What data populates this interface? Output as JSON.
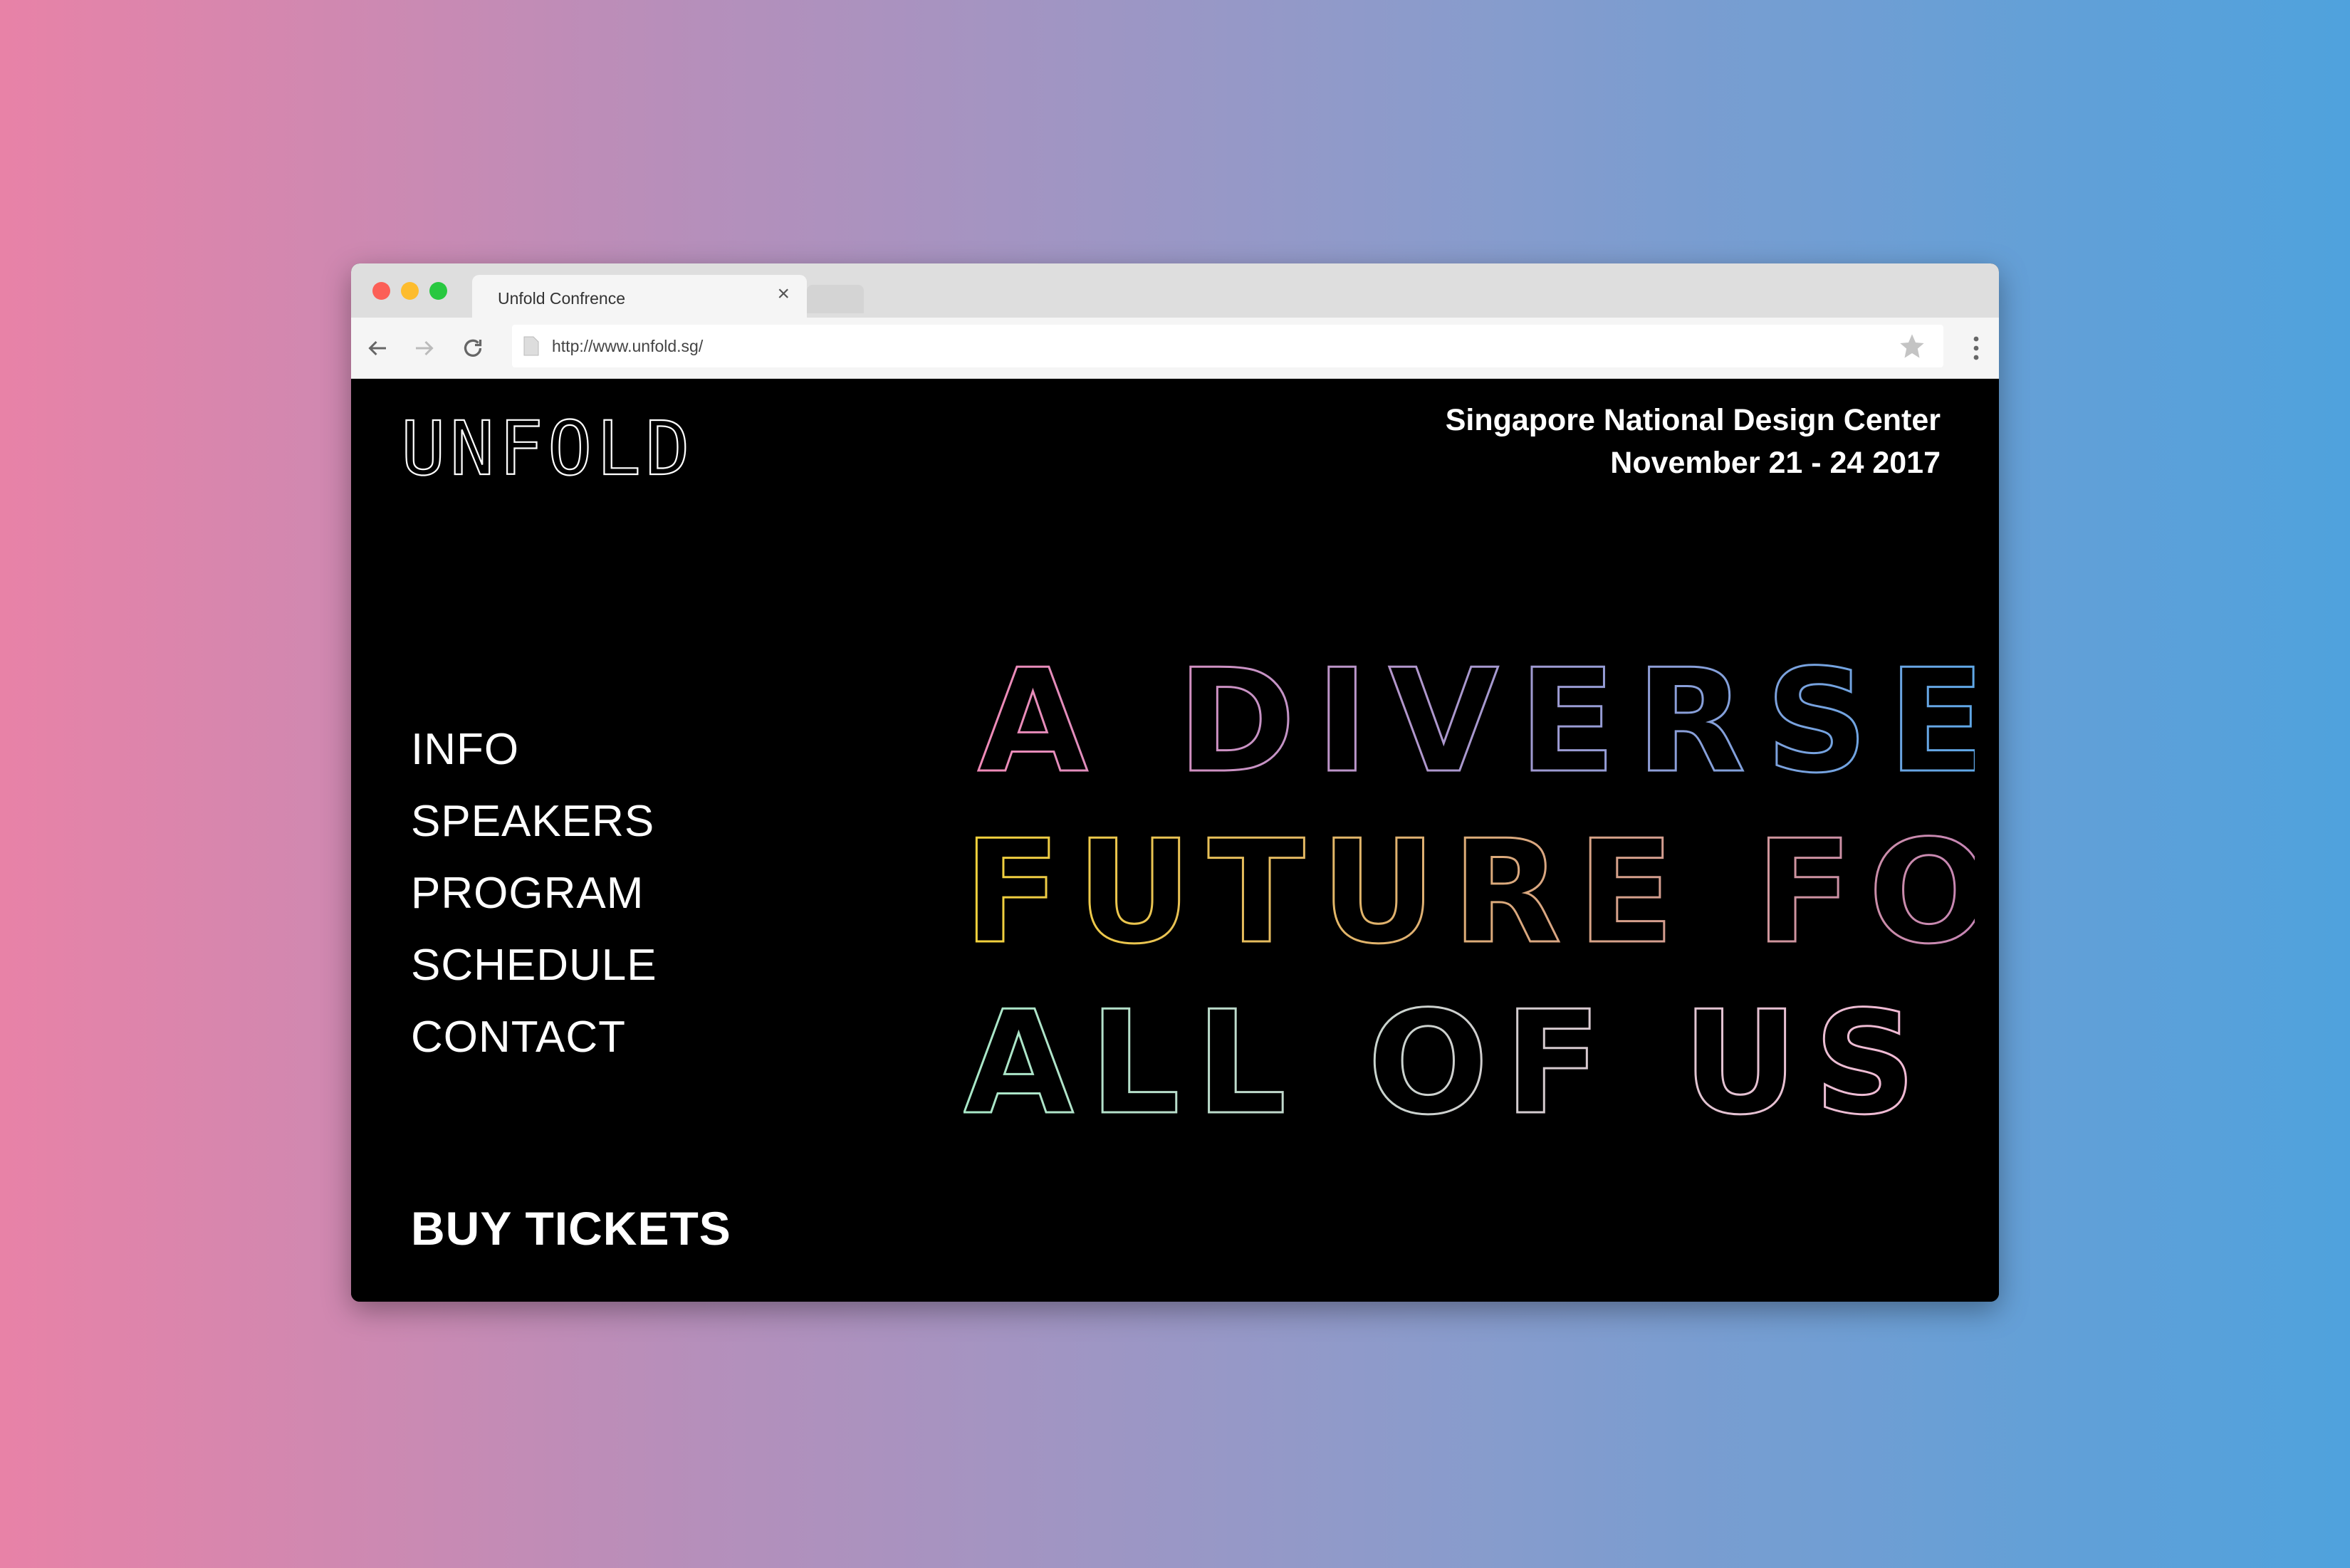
{
  "browser": {
    "tab_title": "Unfold Confrence",
    "tab_close": "×",
    "url": "http://www.unfold.sg/"
  },
  "site": {
    "logo_text": "UNFOLD",
    "venue": "Singapore National Design Center",
    "dates": "November 21 - 24 2017",
    "nav": [
      {
        "label": "INFO"
      },
      {
        "label": "SPEAKERS"
      },
      {
        "label": "PROGRAM"
      },
      {
        "label": "SCHEDULE"
      },
      {
        "label": "CONTACT"
      }
    ],
    "buy_tickets": "BUY TICKETS",
    "headline": {
      "line1": "A DIVERSE",
      "line2": "FUTURE FOR",
      "line3": "ALL OF US"
    }
  },
  "colors": {
    "line1_a": "#F08AB7",
    "line1_b": "#5BA8E8",
    "line2_a": "#F2D23A",
    "line2_b": "#C07AC8",
    "line3_a": "#A8E8C8",
    "line3_b": "#F3B8D4"
  }
}
